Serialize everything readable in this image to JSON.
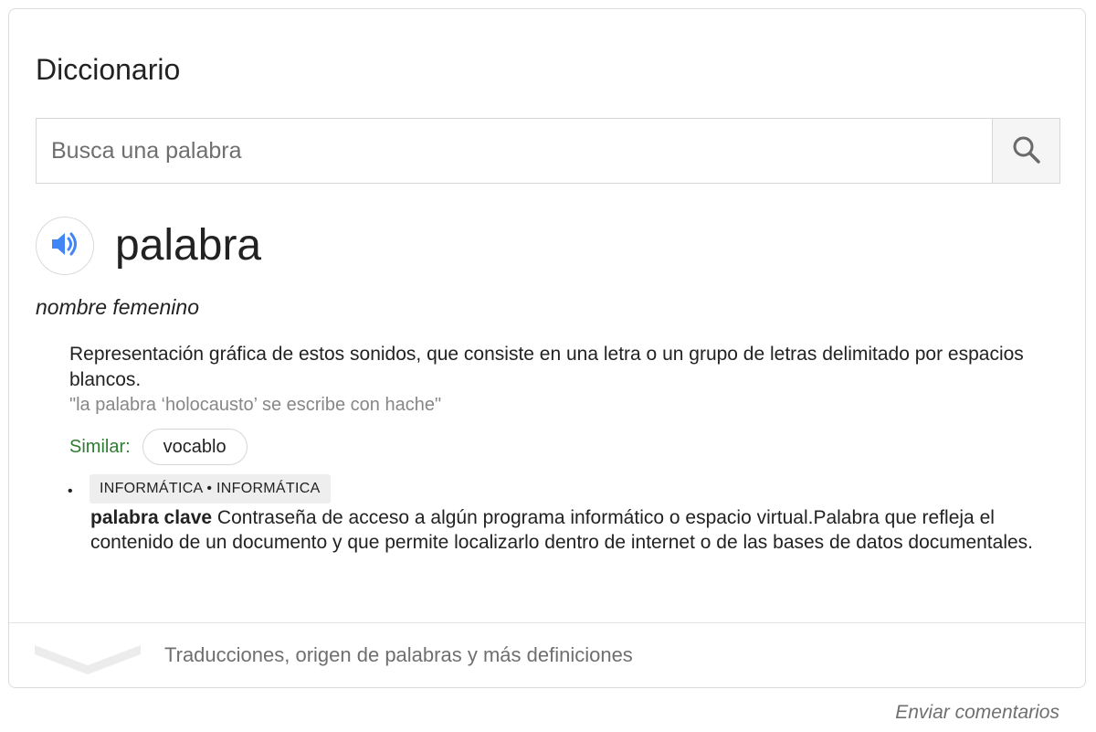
{
  "dictionary": {
    "title": "Diccionario",
    "search": {
      "placeholder": "Busca una palabra",
      "value": ""
    },
    "entry": {
      "word": "palabra",
      "part_of_speech": "nombre femenino",
      "definition": "Representación gráfica de estos sonidos, que consiste en una letra o un grupo de letras delimitado por espacios blancos.",
      "example": "\"la palabra ‘holocausto’ se escribe con hache\"",
      "similar_label": "Similar:",
      "similar_words": [
        "vocablo"
      ],
      "subentry": {
        "domain_tag": "INFORMÁTICA • INFORMÁTICA",
        "term": "palabra clave",
        "definition": " Contraseña de acceso a algún programa informático o espacio virtual.Palabra que refleja el contenido de un documento y que permite localizarlo dentro de internet o de las bases de datos documentales."
      }
    },
    "more_link": "Traducciones, origen de palabras y más definiciones",
    "feedback_link": "Enviar comentarios"
  },
  "icons": {
    "search": "search-icon",
    "speaker": "speaker-icon",
    "chevron": "chevron-down-icon"
  },
  "colors": {
    "speaker_blue": "#4285f4",
    "similar_green": "#2e7d32",
    "muted_text": "#6f6f6f",
    "example_text": "#878787"
  }
}
